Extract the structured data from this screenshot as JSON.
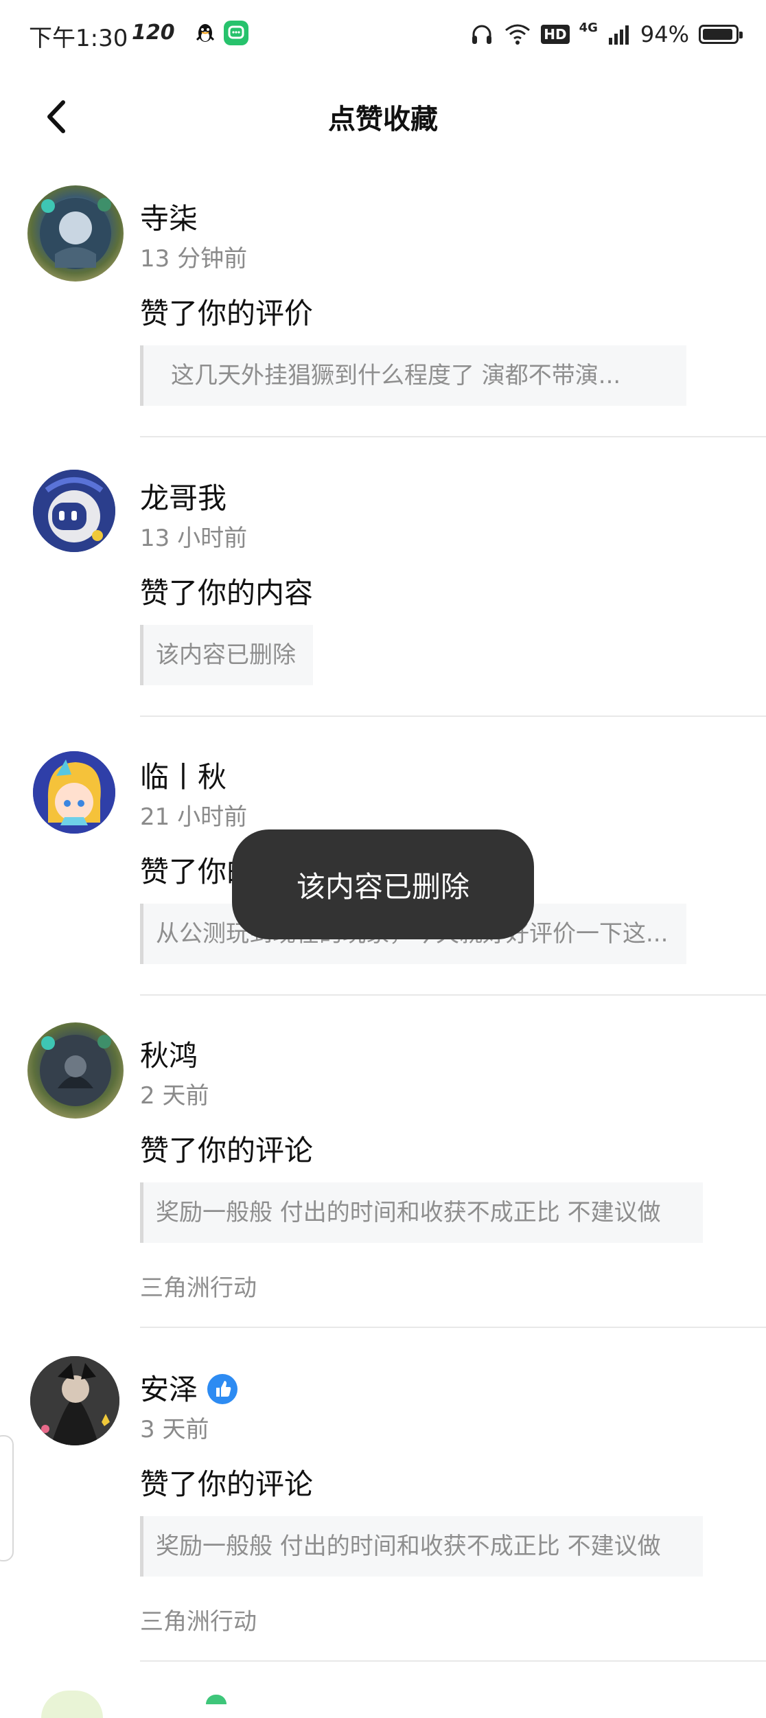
{
  "status_bar": {
    "time": "下午1:30",
    "refresh_rate": "120",
    "battery_text": "94%",
    "battery_level": 0.94,
    "network_type": "4G",
    "hd_label": "HD"
  },
  "nav": {
    "title": "点赞收藏",
    "back_icon": "chevron-left-icon"
  },
  "items": [
    {
      "name": "寺柒",
      "time": "13 分钟前",
      "action": "赞了你的评价",
      "quote": "这几天外挂猖獗到什么程度了 演都不带演..."
    },
    {
      "name": "龙哥我",
      "time": "13 小时前",
      "action": "赞了你的内容",
      "quote": "该内容已删除"
    },
    {
      "name": "临丨秋",
      "time": "21 小时前",
      "action": "赞了你的评价",
      "quote": "从公测玩到现在的玩家，今天就好好评价一下这..."
    },
    {
      "name": "秋鸿",
      "time": "2 天前",
      "action": "赞了你的评论",
      "quote": "奖励一般般 付出的时间和收获不成正比 不建议做",
      "tag": "三角洲行动"
    },
    {
      "name": "安泽",
      "time": "3 天前",
      "action": "赞了你的评论",
      "quote": "奖励一般般 付出的时间和收获不成正比 不建议做",
      "tag": "三角洲行动",
      "verified_icon": "thumbs-up-badge-icon"
    }
  ],
  "toast": {
    "text": "该内容已删除"
  },
  "colors": {
    "accent_blue": "#2d8bf2",
    "toast_bg": "#333333",
    "secondary_text": "#8e8e8e"
  }
}
